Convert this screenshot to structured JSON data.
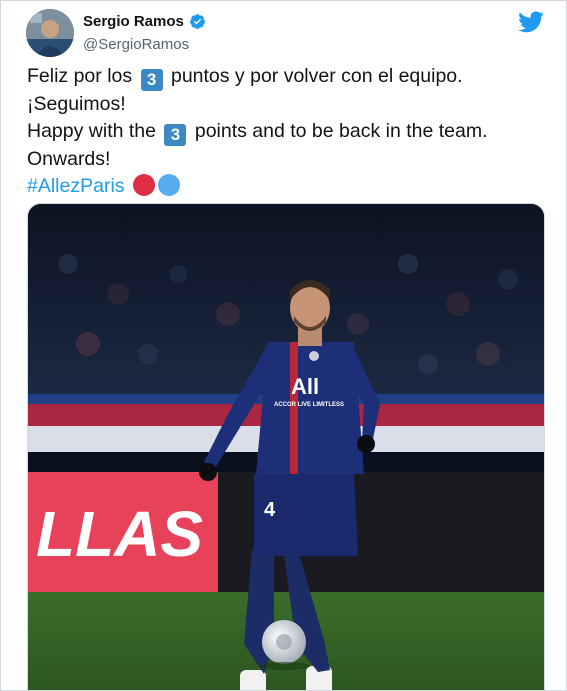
{
  "tweet": {
    "author_name": "Sergio Ramos",
    "author_handle": "@SergioRamos",
    "lines": {
      "es_before": "Feliz por los",
      "es_number": "3",
      "es_after": "puntos y por volver con el equipo.",
      "es_2": "¡Seguimos!",
      "en_before": "Happy with the",
      "en_number": "3",
      "en_after": "points and to be back in the team.",
      "en_2": "Onwards!",
      "hashtag": "#AllezParis"
    },
    "emoji": {
      "keycap_color": "#3b88c3",
      "red_circle": "#dd2e44",
      "blue_circle": "#55acee"
    }
  },
  "media": {
    "banner_text": "LLAS",
    "shirt_logo": "All",
    "shirt_sponsor": "ACCOR LIVE LIMITLESS",
    "shirt_number": "4"
  },
  "icons": {
    "verified": "verified-badge-icon",
    "twitter": "twitter-bird-icon"
  },
  "colors": {
    "link": "#1d9bf0",
    "secondary_text": "#536471",
    "verified": "#1d9bf0"
  }
}
